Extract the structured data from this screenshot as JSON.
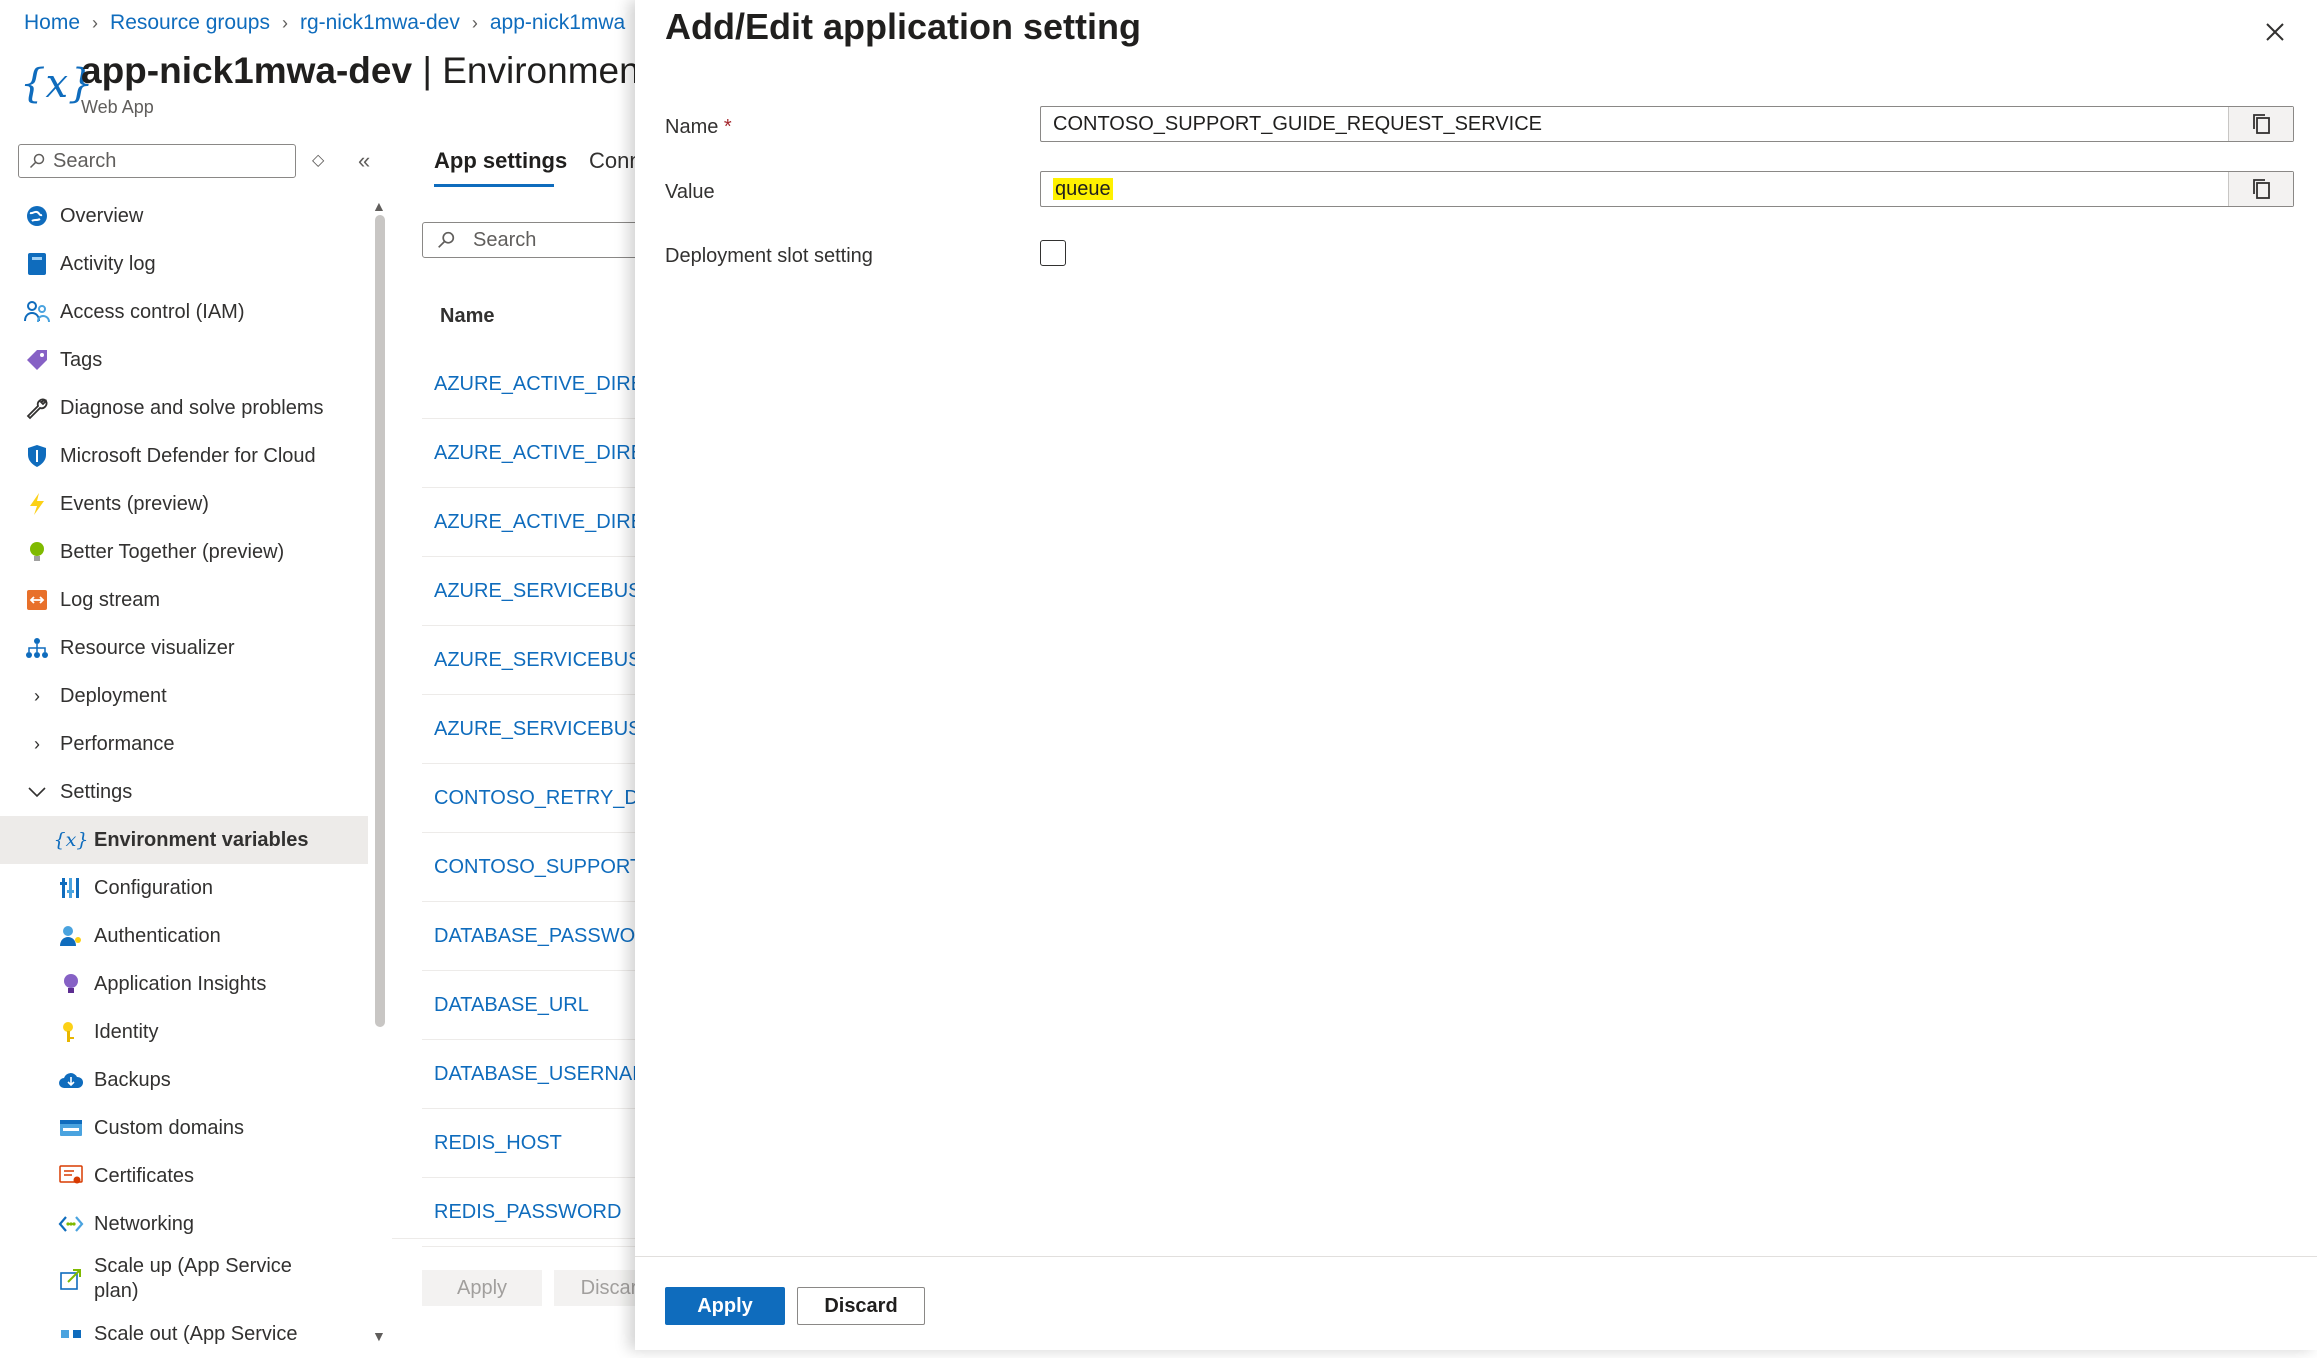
{
  "breadcrumb": [
    "Home",
    "Resource groups",
    "rg-nick1mwa-dev",
    "app-nick1mwa"
  ],
  "header": {
    "resource_name": "app-nick1mwa-dev",
    "separator": " | ",
    "page_name": "Environment v",
    "subtitle": "Web App"
  },
  "sidebar": {
    "search_placeholder": "Search",
    "items": [
      {
        "label": "Overview",
        "icon": "globe-icon"
      },
      {
        "label": "Activity log",
        "icon": "log-book-icon"
      },
      {
        "label": "Access control (IAM)",
        "icon": "people-icon"
      },
      {
        "label": "Tags",
        "icon": "tag-icon"
      },
      {
        "label": "Diagnose and solve problems",
        "icon": "wrench-icon"
      },
      {
        "label": "Microsoft Defender for Cloud",
        "icon": "shield-icon"
      },
      {
        "label": "Events (preview)",
        "icon": "lightning-icon"
      },
      {
        "label": "Better Together (preview)",
        "icon": "lightbulb-icon"
      },
      {
        "label": "Log stream",
        "icon": "log-stream-icon"
      },
      {
        "label": "Resource visualizer",
        "icon": "hierarchy-icon"
      },
      {
        "label": "Deployment",
        "icon": "chevron-right-icon"
      },
      {
        "label": "Performance",
        "icon": "chevron-right-icon"
      },
      {
        "label": "Settings",
        "icon": "chevron-down-icon"
      },
      {
        "label": "Environment variables",
        "icon": "variable-icon"
      },
      {
        "label": "Configuration",
        "icon": "sliders-icon"
      },
      {
        "label": "Authentication",
        "icon": "user-key-icon"
      },
      {
        "label": "Application Insights",
        "icon": "insights-bulb-icon"
      },
      {
        "label": "Identity",
        "icon": "key-icon"
      },
      {
        "label": "Backups",
        "icon": "cloud-backup-icon"
      },
      {
        "label": "Custom domains",
        "icon": "www-icon"
      },
      {
        "label": "Certificates",
        "icon": "certificate-icon"
      },
      {
        "label": "Networking",
        "icon": "network-icon"
      },
      {
        "label": "Scale up (App Service plan)",
        "icon": "scale-up-icon"
      },
      {
        "label": "Scale out (App Service",
        "icon": "scale-out-icon"
      }
    ]
  },
  "main": {
    "tabs": [
      "App settings",
      "Conn"
    ],
    "search_placeholder": "Search",
    "column_name": "Name",
    "rows": [
      "AZURE_ACTIVE_DIRECT",
      "AZURE_ACTIVE_DIRECT",
      "AZURE_ACTIVE_DIRECT",
      "AZURE_SERVICEBUS_EN",
      "AZURE_SERVICEBUS_EN",
      "AZURE_SERVICEBUS_NA",
      "CONTOSO_RETRY_DEM",
      "CONTOSO_SUPPORT_G",
      "DATABASE_PASSWORD",
      "DATABASE_URL",
      "DATABASE_USERNAME",
      "REDIS_HOST",
      "REDIS_PASSWORD"
    ],
    "apply_label": "Apply",
    "discard_label": "Discar"
  },
  "panel": {
    "title": "Add/Edit application setting",
    "name_label": "Name",
    "required_marker": "*",
    "name_value": "CONTOSO_SUPPORT_GUIDE_REQUEST_SERVICE",
    "value_label": "Value",
    "value_value": "queue",
    "slot_label": "Deployment slot setting",
    "slot_checked": false,
    "apply_label": "Apply",
    "discard_label": "Discard"
  },
  "colors": {
    "accent": "#0f6cbd",
    "highlight": "#fff100"
  }
}
